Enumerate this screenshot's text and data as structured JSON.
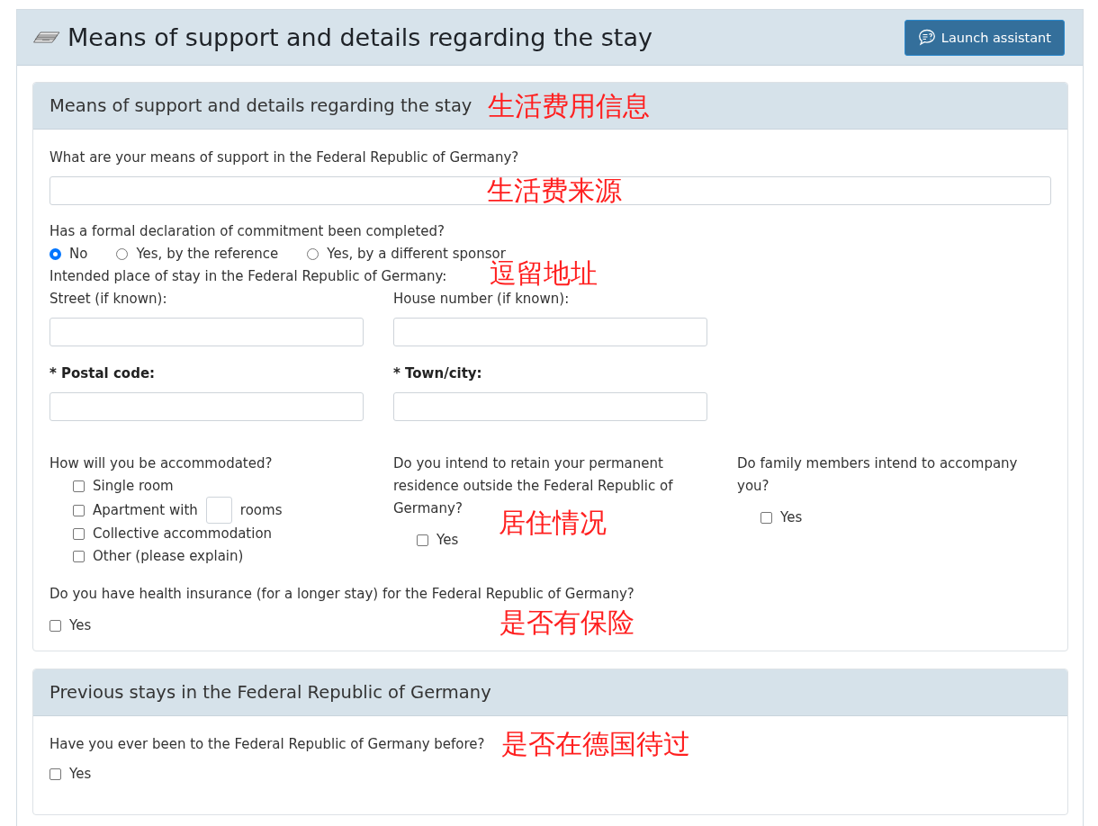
{
  "header": {
    "title": "Means of support and details regarding the stay",
    "assistant_button": "Launch assistant"
  },
  "support_section": {
    "title": "Means of support and details regarding the stay",
    "annotation": "生活费用信息",
    "means_of_support": {
      "label": "What are your means of support in the Federal Republic of Germany?",
      "annotation": "生活费来源"
    },
    "commitment": {
      "label": "Has a formal declaration of commitment been completed?",
      "options": [
        {
          "label": "No",
          "selected": true
        },
        {
          "label": "Yes, by the reference",
          "selected": false
        },
        {
          "label": "Yes, by a different sponsor",
          "selected": false
        }
      ]
    },
    "place_of_stay": {
      "label": "Intended place of stay in the Federal Republic of Germany:",
      "annotation": "逗留地址",
      "fields": [
        {
          "label": "Street (if known):",
          "required": false
        },
        {
          "label": "House number (if known):",
          "required": false
        },
        {
          "label": "* Postal code:",
          "required": true
        },
        {
          "label": "* Town/city:",
          "required": true
        }
      ]
    },
    "accommodation": {
      "label": "How will you be accommodated?",
      "options": [
        {
          "kind": "checkbox",
          "label": "Single room",
          "checked": false
        },
        {
          "kind": "rooms",
          "label": "Apartment with",
          "suffix": "rooms",
          "checked": false
        },
        {
          "kind": "checkbox",
          "label": "Collective accommodation",
          "checked": false
        },
        {
          "kind": "checkbox",
          "label": "Other (please explain)",
          "checked": false
        }
      ]
    },
    "permanent_residence": {
      "label": "Do you intend to retain your permanent residence outside the Federal Republic of Germany?",
      "annotation": "居住情况",
      "option": {
        "label": "Yes",
        "checked": false
      }
    },
    "family": {
      "label": "Do family members intend to accompany you?",
      "option": {
        "label": "Yes",
        "checked": false
      }
    },
    "health_insurance": {
      "label": "Do you have health insurance (for a longer stay) for the Federal Republic of Germany?",
      "annotation": "是否有保险",
      "option": {
        "label": "Yes",
        "checked": false
      }
    }
  },
  "previous_stays_section": {
    "title": "Previous stays in the Federal Republic of Germany",
    "question": {
      "label": "Have you ever been to the Federal Republic of Germany before?",
      "annotation": "是否在德国待过",
      "option": {
        "label": "Yes",
        "checked": false
      }
    }
  }
}
